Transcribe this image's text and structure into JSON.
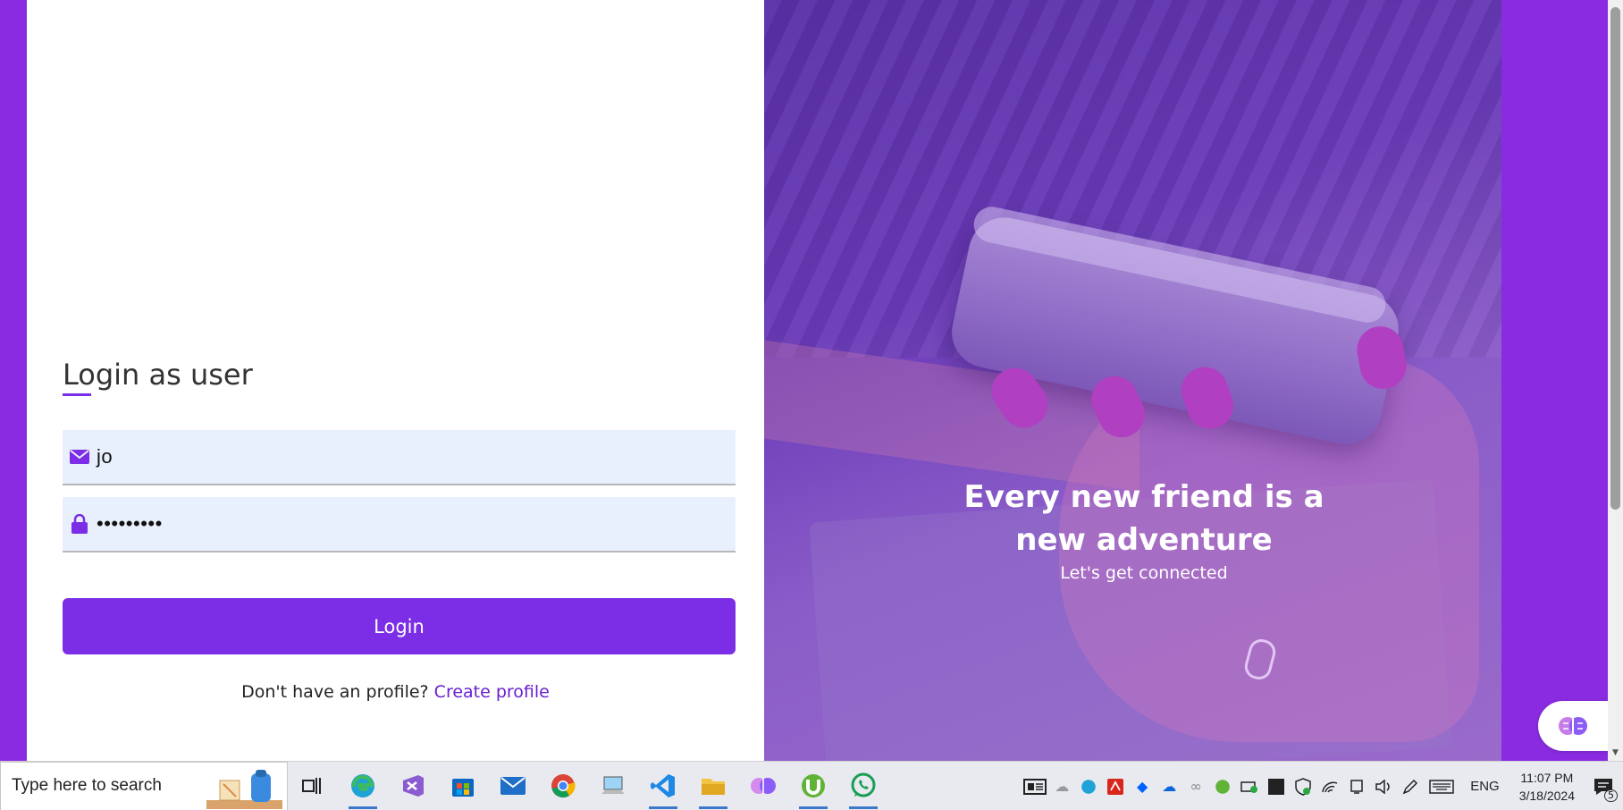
{
  "colors": {
    "accent": "#7b2ee6",
    "page_bg": "#8a2be2",
    "input_bg": "#e8f0fe",
    "link": "#6a1fd0"
  },
  "login": {
    "title": "Login as user",
    "email_icon": "envelope-icon",
    "email_value": "jo",
    "password_icon": "lock-icon",
    "password_value": "•••••••••",
    "login_button": "Login",
    "signup_prompt": "Don't have an profile?",
    "signup_link": "Create profile"
  },
  "hero": {
    "headline": "Every new friend is a new adventure",
    "subline": "Let's get connected"
  },
  "taskbar": {
    "search_placeholder": "Type here to search",
    "apps": [
      "task-view",
      "edge",
      "visual-studio",
      "microsoft-store",
      "mail",
      "chrome",
      "computer",
      "vscode",
      "file-explorer",
      "brain-app",
      "utorrent",
      "whatsapp"
    ],
    "language": "ENG",
    "time": "11:07 PM",
    "date": "3/18/2024",
    "notification_count": "5"
  }
}
